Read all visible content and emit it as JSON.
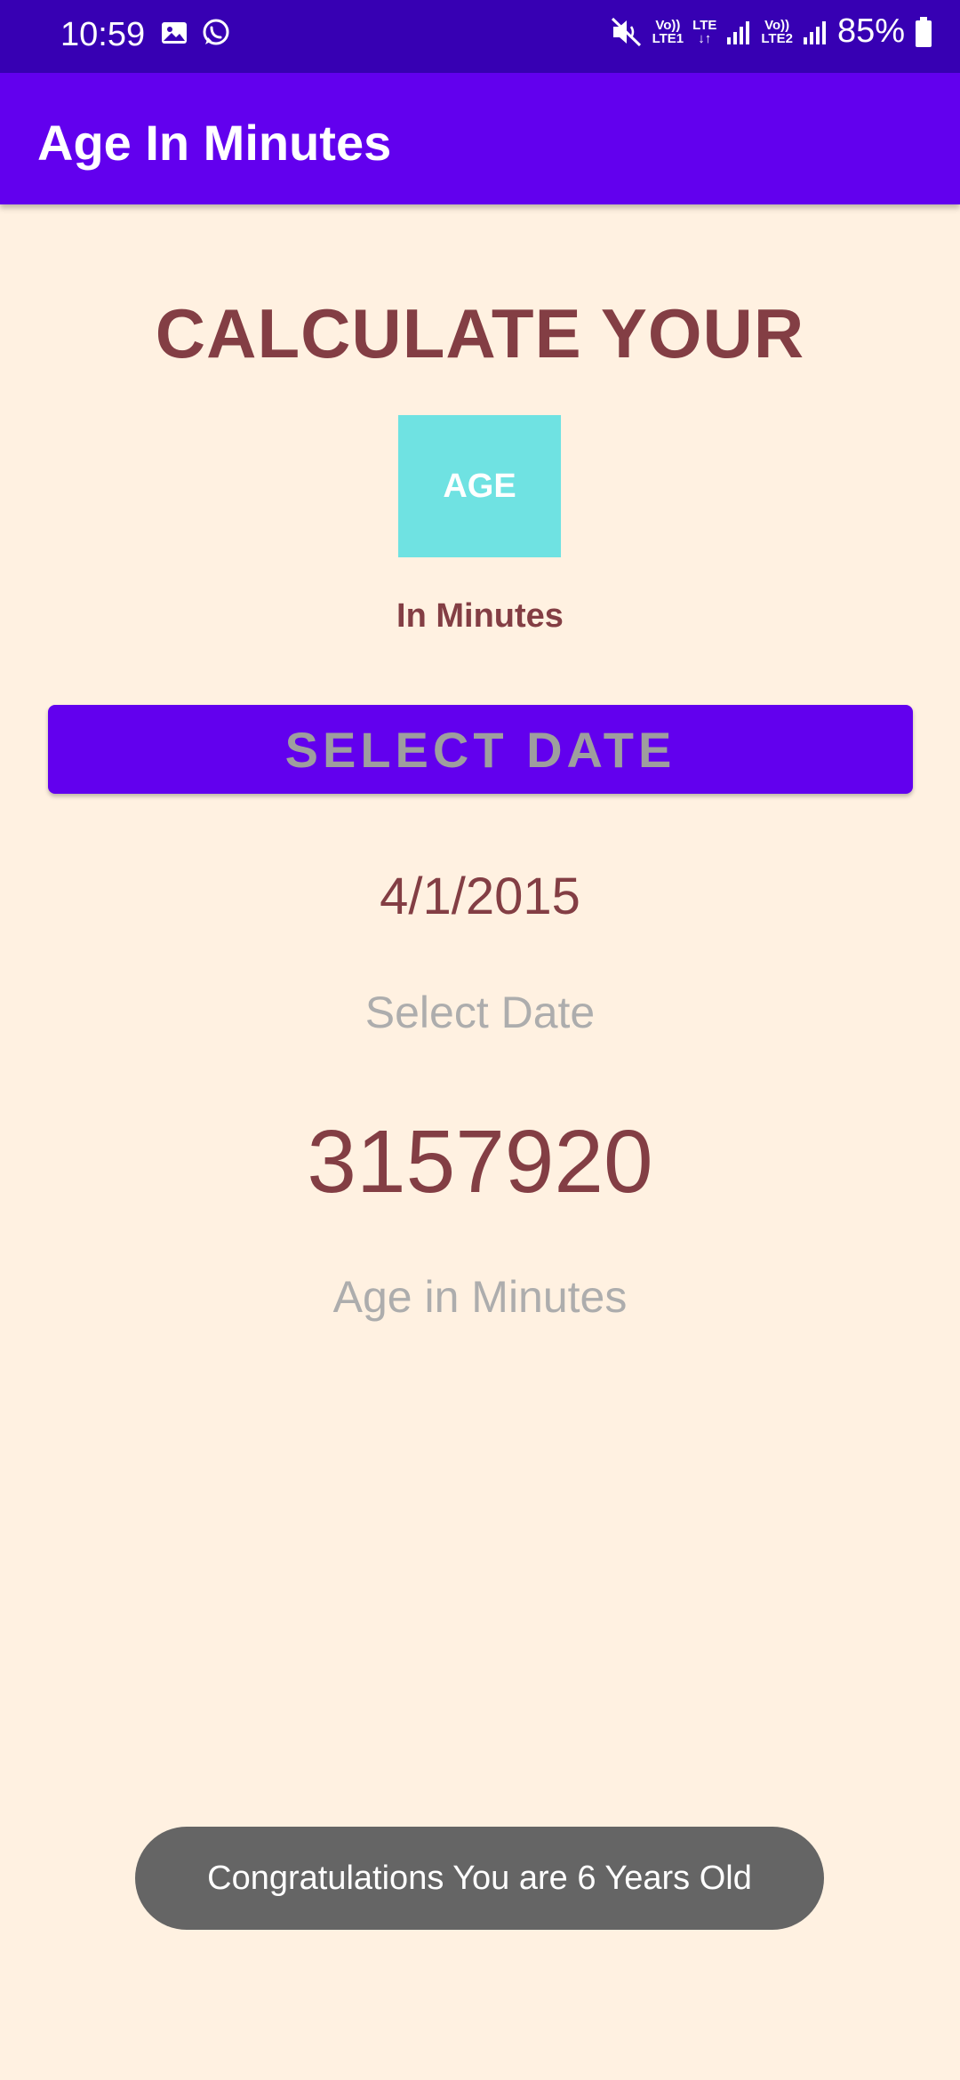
{
  "status_bar": {
    "time": "10:59",
    "left_icons": [
      "gallery-icon",
      "whatsapp-icon"
    ],
    "network_1": {
      "top": "Vo))",
      "bottom": "LTE1"
    },
    "network_lte": "LTE",
    "network_2": {
      "top": "Vo))",
      "bottom": "LTE2"
    },
    "battery": "85%"
  },
  "app_bar": {
    "title": "Age In Minutes"
  },
  "main": {
    "heading": "CALCULATE YOUR",
    "age_box": "AGE",
    "subheading": "In Minutes",
    "select_button": "SELECT DATE",
    "selected_date": "4/1/2015",
    "selected_date_label": "Select Date",
    "age_in_minutes": "3157920",
    "age_in_minutes_label": "Age in Minutes"
  },
  "toast": {
    "message": "Congratulations You are 6 Years Old"
  },
  "colors": {
    "status_bar": "#3700B3",
    "app_bar": "#6200EE",
    "background": "#FFF1E1",
    "accent_text": "#833E44",
    "age_box": "#6FE2E2",
    "hint_text": "#ADADAD"
  }
}
